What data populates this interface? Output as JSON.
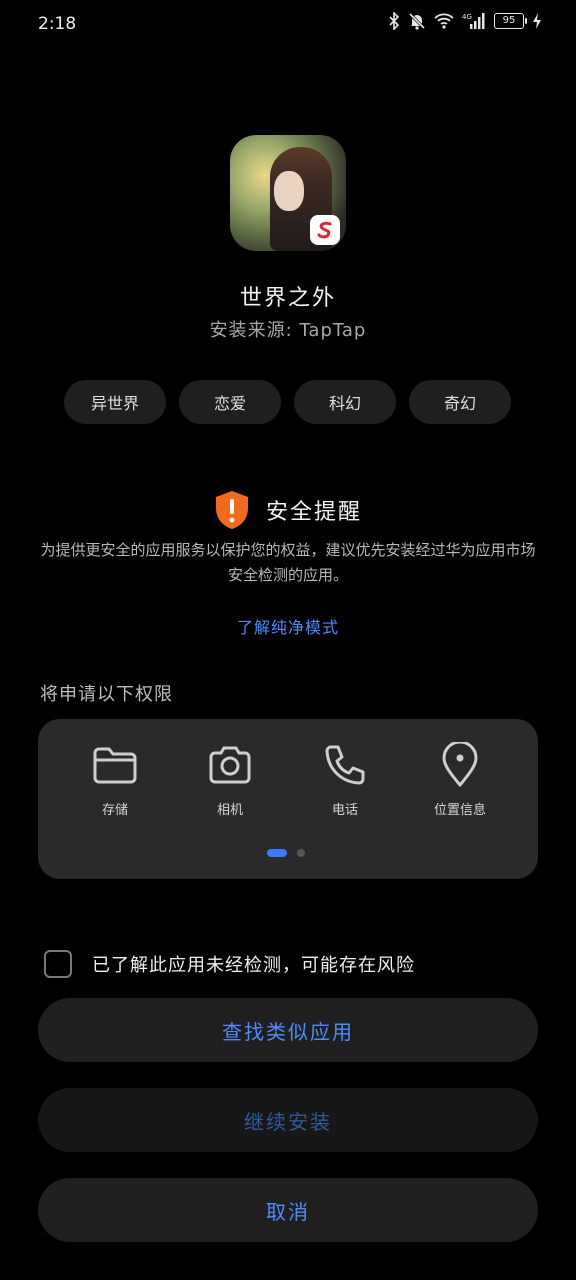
{
  "status_bar": {
    "time": "2:18",
    "battery": "95",
    "network": "4G"
  },
  "app": {
    "name": "世界之外",
    "source": "安装来源: TapTap"
  },
  "tags": [
    "异世界",
    "恋爱",
    "科幻",
    "奇幻"
  ],
  "safety": {
    "title": "安全提醒",
    "description": "为提供更安全的应用服务以保护您的权益，建议优先安装经过华为应用市场安全检测的应用。",
    "learn_more": "了解纯净模式"
  },
  "permissions": {
    "header": "将申请以下权限",
    "items": [
      {
        "label": "存储",
        "icon": "folder-icon"
      },
      {
        "label": "相机",
        "icon": "camera-icon"
      },
      {
        "label": "电话",
        "icon": "phone-icon"
      },
      {
        "label": "位置信息",
        "icon": "location-icon"
      }
    ],
    "page_indicator": {
      "current": 1,
      "total": 2
    }
  },
  "acknowledge": {
    "label": "已了解此应用未经检测，可能存在风险",
    "checked": false
  },
  "buttons": {
    "find_similar": "查找类似应用",
    "continue_install": "继续安装",
    "cancel": "取消"
  },
  "colors": {
    "background": "#000000",
    "accent": "#4d8cff",
    "warning": "#f26b1d",
    "card": "#2a2a2a"
  }
}
